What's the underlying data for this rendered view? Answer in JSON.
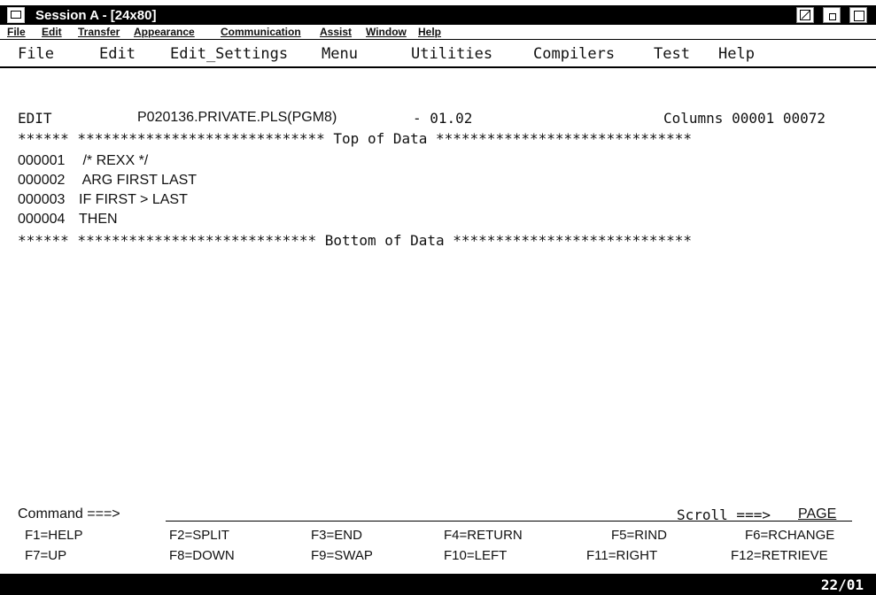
{
  "window": {
    "title": "Session A - [24x80]"
  },
  "menubar": {
    "items": [
      "File",
      "Edit",
      "Transfer",
      "Appearance",
      "Communication",
      "Assist",
      "Window",
      "Help"
    ]
  },
  "ispf_menu": {
    "items": [
      "File",
      "Edit",
      "Edit_Settings",
      "Menu",
      "Utilities",
      "Compilers",
      "Test",
      "Help"
    ]
  },
  "editor": {
    "mode": "EDIT",
    "dataset": "P020136.PRIVATE.PLS(PGM8)",
    "level": "- 01.02",
    "columns": "Columns 00001 00072",
    "top_of_data": "****** ***************************** Top of Data ******************************",
    "lines": [
      {
        "num": "000001",
        "text": " /* REXX */"
      },
      {
        "num": "000002",
        "text": " ARG FIRST LAST"
      },
      {
        "num": "000003",
        "text": "IF FIRST > LAST"
      },
      {
        "num": "000004",
        "text": "THEN"
      }
    ],
    "bottom_of_data": "****** **************************** Bottom of Data ****************************"
  },
  "command": {
    "label": "Command ===>",
    "value": "",
    "scroll_label": "Scroll ===>",
    "scroll_value": "PAGE"
  },
  "fkeys": {
    "row1": [
      "F1=HELP",
      "F2=SPLIT",
      "F3=END",
      "F4=RETURN",
      "F5=RIND",
      "F6=RCHANGE"
    ],
    "row2": [
      "F7=UP",
      "F8=DOWN",
      "F9=SWAP",
      "F10=LEFT",
      "F11=RIGHT",
      "F12=RETRIEVE"
    ]
  },
  "status": {
    "cursor": "22/01"
  }
}
